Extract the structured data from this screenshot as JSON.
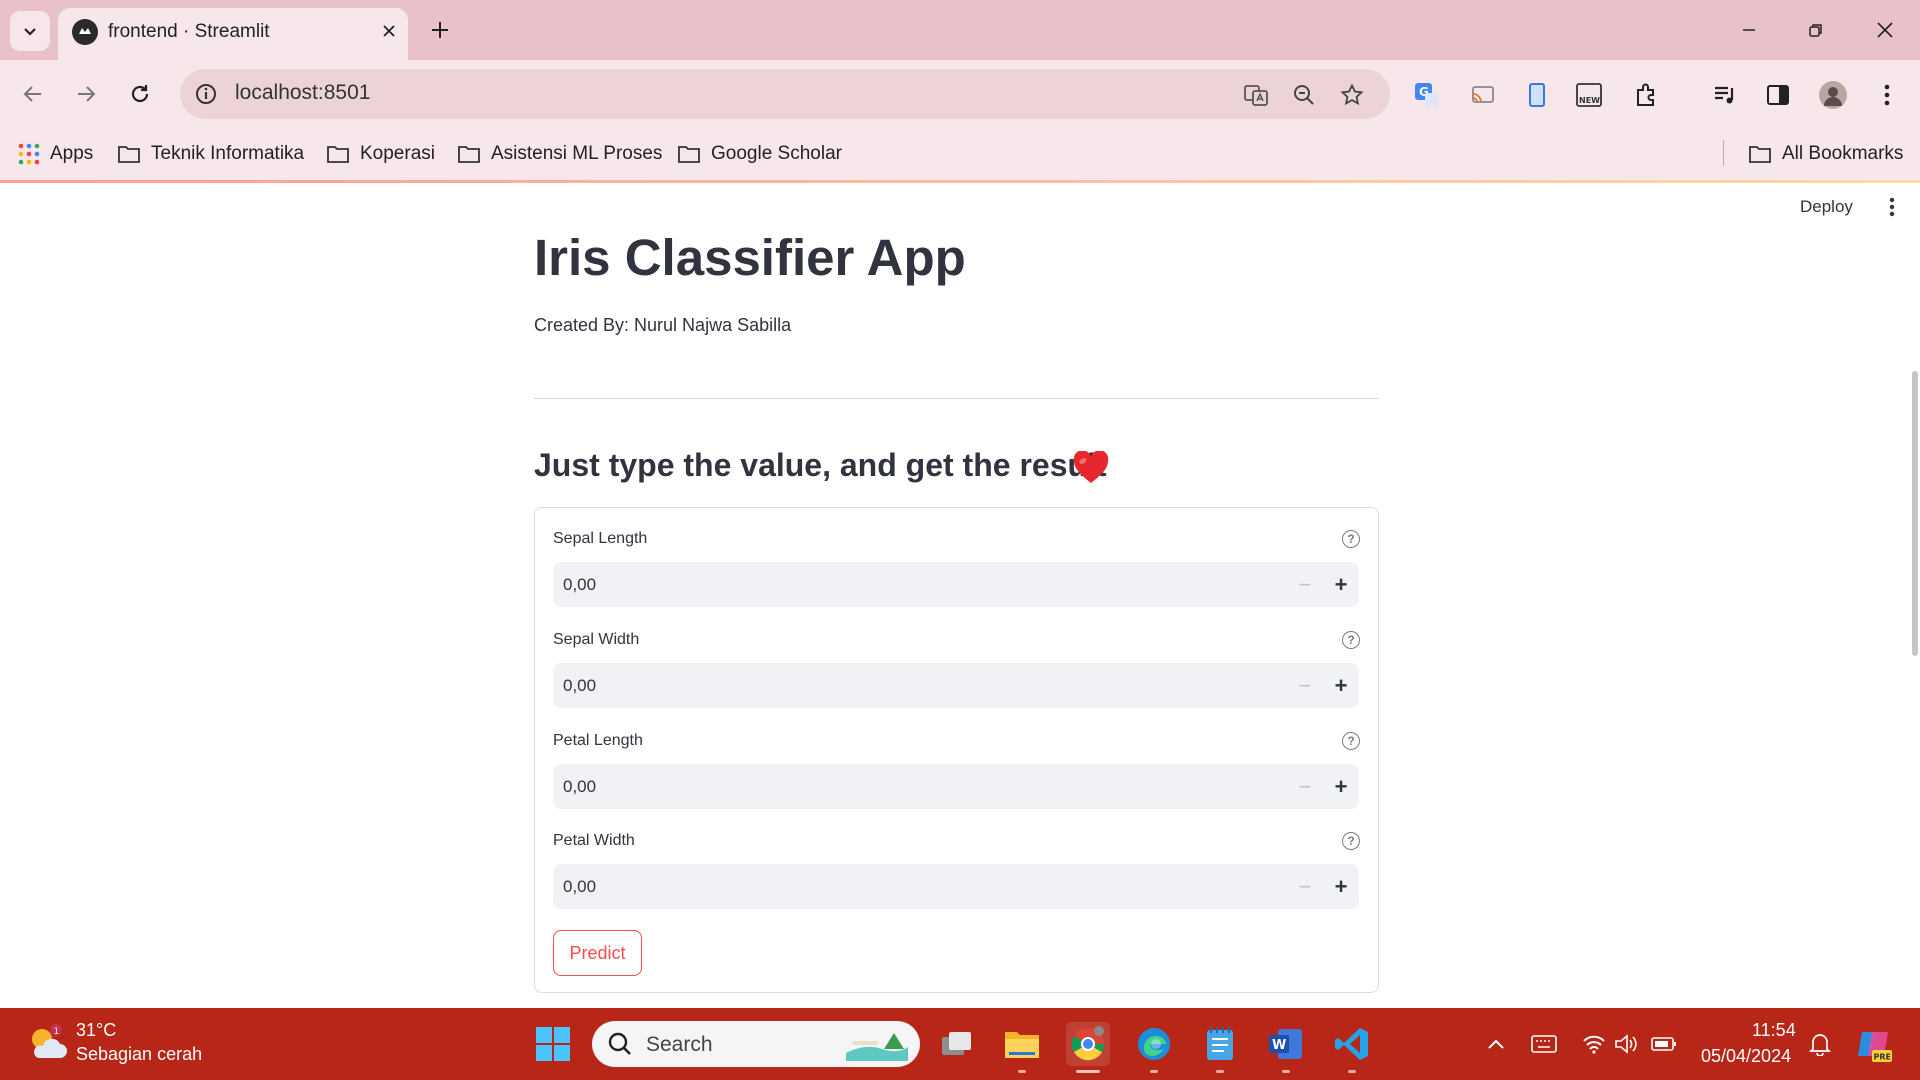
{
  "browser": {
    "tab_title": "frontend · Streamlit",
    "url": "localhost:8501",
    "bookmarks": [
      "Apps",
      "Teknik Informatika",
      "Koperasi",
      "Asistensi ML Proses",
      "Google Scholar"
    ],
    "all_bookmarks": "All Bookmarks",
    "accent_color": "#e9c2c9"
  },
  "app": {
    "deploy_label": "Deploy",
    "title": "Iris Classifier App",
    "caption": "Created By: Nurul Najwa Sabilla",
    "subheader": "Just type the value, and get the result",
    "fields": [
      {
        "label": "Sepal Length",
        "value": "0,00"
      },
      {
        "label": "Sepal Width",
        "value": "0,00"
      },
      {
        "label": "Petal Length",
        "value": "0,00"
      },
      {
        "label": "Petal Width",
        "value": "0,00"
      }
    ],
    "predict_label": "Predict",
    "primary_color": "#ff4b4b"
  },
  "taskbar": {
    "weather_badge": "1",
    "temperature": "31°C",
    "weather": "Sebagian cerah",
    "search_label": "Search",
    "time": "11:54",
    "date": "05/04/2024",
    "copilot_badge": "PRE"
  }
}
